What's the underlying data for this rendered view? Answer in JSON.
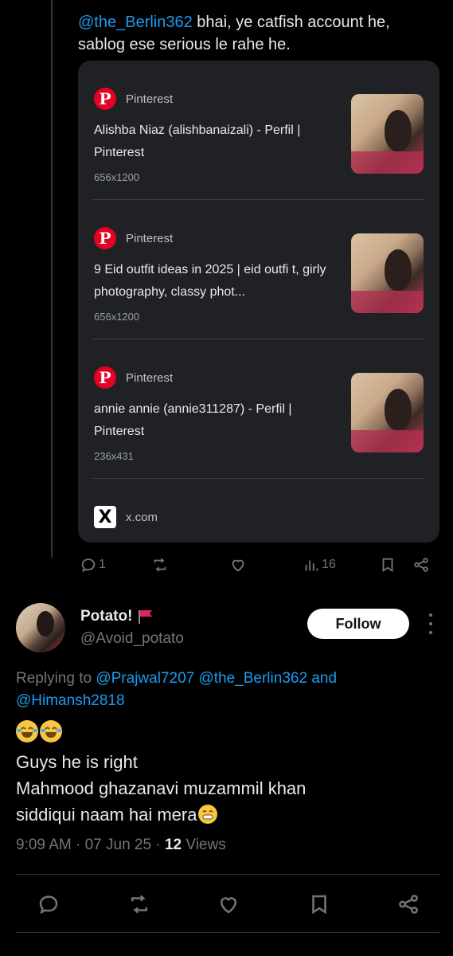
{
  "parent_reply": {
    "mention": "@the_Berlin362",
    "text": " bhai, ye catfish account he, sablog ese serious le rahe he."
  },
  "search_results": [
    {
      "source": "Pinterest",
      "title": "Alishba Niaz (alishbanaizali) - Perfil | Pinterest",
      "size": "656x1200",
      "logo": "pinterest-icon"
    },
    {
      "source": "Pinterest",
      "title": "9 Eid outfit ideas in 2025 | eid outfi t, girly photography, classy phot...",
      "size": "656x1200",
      "logo": "pinterest-icon"
    },
    {
      "source": "Pinterest",
      "title": "annie annie (annie311287) - Perfil | Pinterest",
      "size": "236x431",
      "logo": "pinterest-icon"
    },
    {
      "source": "x.com",
      "title": "",
      "size": "",
      "logo": "x-icon"
    }
  ],
  "parent_actions": {
    "reply_count": "1",
    "views_count": "16"
  },
  "tweet": {
    "display_name": "Potato!",
    "handle": "@Avoid_potato",
    "follow_label": "Follow",
    "replying_prefix": "Replying to",
    "replying_mentions": "@Prajwal7207 @the_Berlin362",
    "replying_and": "and",
    "replying_last": "@Himansh2818",
    "body_line1": "Guys he is right",
    "body_line2": "Mahmood ghazanavi muzammil khan",
    "body_line3": "siddiqui naam hai mera",
    "time": "9:09 AM · 07 Jun 25 · ",
    "views_count": "12",
    "views_label": " Views"
  },
  "colors": {
    "background": "#000000",
    "link": "#1d9bf0",
    "muted": "#71767b",
    "card": "#202124",
    "pinterest_red": "#e60023"
  }
}
